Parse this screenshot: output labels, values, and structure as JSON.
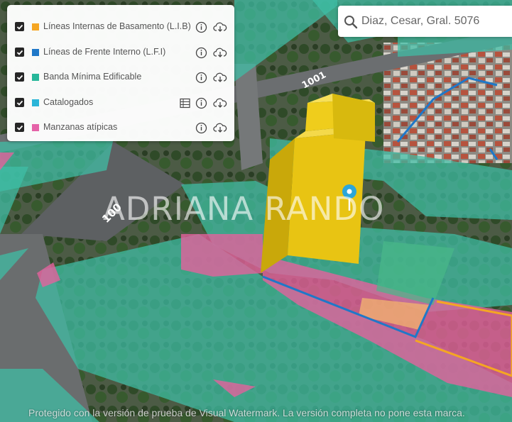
{
  "layers_panel": {
    "layers": [
      {
        "label": "Líneas Internas de Basamento (L.I.B)",
        "color": "#f5a623",
        "checked": true,
        "has_table": false
      },
      {
        "label": "Líneas de Frente Interno (L.F.I)",
        "color": "#1f78c8",
        "checked": true,
        "has_table": false
      },
      {
        "label": "Banda Mínima Edificable",
        "color": "#27b79a",
        "checked": true,
        "has_table": false
      },
      {
        "label": "Catalogados",
        "color": "#2bb5d8",
        "checked": true,
        "has_table": true
      },
      {
        "label": "Manzanas atípicas",
        "color": "#e563a8",
        "checked": true,
        "has_table": false
      }
    ]
  },
  "search": {
    "value": "Diaz, Cesar, Gral. 5076"
  },
  "map": {
    "street_label_1": "1001",
    "street_label_2": "100"
  },
  "watermark": {
    "big_text": "ADRIANA RANDO",
    "bottom_text": "Protegido con la versión de prueba de Visual Watermark. La versión completa no pone esta marca."
  },
  "colors": {
    "teal_overlay": "#3fbfa6",
    "pink_overlay": "#e8609e",
    "building_yellow": "#e8c413",
    "lfi_blue": "#1f78c8",
    "lib_orange": "#f5a623"
  }
}
